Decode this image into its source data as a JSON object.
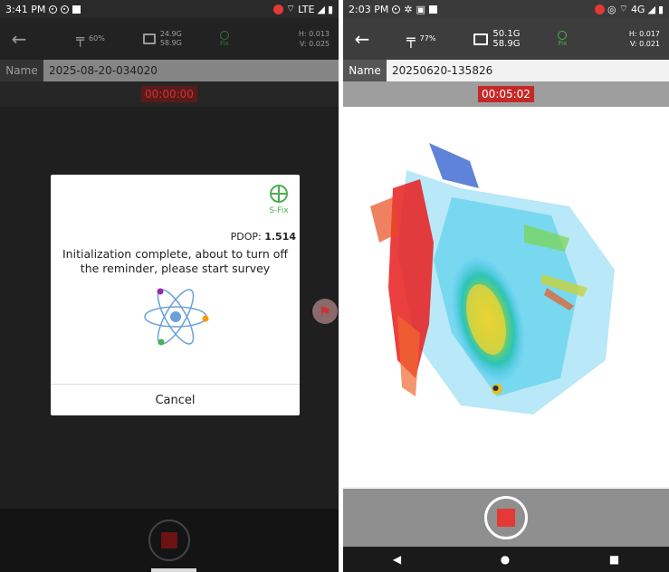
{
  "left": {
    "status": {
      "time": "3:41 PM",
      "network": "LTE"
    },
    "toolbar": {
      "battery": "60%",
      "storage_used": "24.9G",
      "storage_total": "58.9G",
      "fix": "Fix",
      "h": "H: 0.013",
      "v": "V: 0.025"
    },
    "name_label": "Name",
    "name_value": "2025-08-20-034020",
    "timer": "00:00:00",
    "dialog": {
      "fix_label": "S-Fix",
      "pdop_label": "PDOP:",
      "pdop_value": "1.514",
      "message": "Initialization complete, about to turn off the reminder, please start survey",
      "cancel": "Cancel"
    }
  },
  "right": {
    "status": {
      "time": "2:03 PM",
      "network": "4G"
    },
    "toolbar": {
      "battery": "77%",
      "storage_used": "50.1G",
      "storage_total": "58.9G",
      "fix": "Fix",
      "h": "H: 0.017",
      "v": "V: 0.021"
    },
    "name_label": "Name",
    "name_value": "20250620-135826",
    "timer": "00:05:02"
  },
  "colors": {
    "record_red": "#e53935",
    "fix_green": "#4caf50",
    "timer_bg": "#c62828"
  }
}
